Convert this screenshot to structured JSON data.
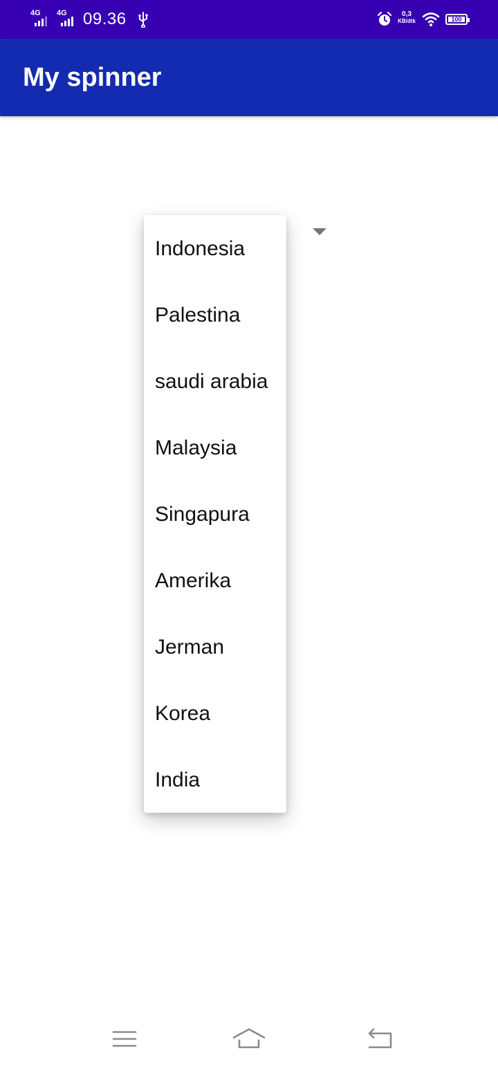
{
  "status_bar": {
    "signal_1_label": "4G",
    "signal_2_label": "4G",
    "time": "09.36",
    "net_speed_value": "0,3",
    "net_speed_unit": "KB/dtk",
    "battery_level": "100",
    "icons": [
      "signal-icon",
      "signal-icon",
      "usb-icon",
      "alarm-icon",
      "wifi-icon",
      "battery-icon"
    ],
    "background_color": "#3700b3"
  },
  "app_bar": {
    "title": "My spinner",
    "background_color": "#132bb0"
  },
  "spinner": {
    "arrow_icon": "dropdown-arrow-icon",
    "options": [
      "Indonesia",
      "Palestina",
      "saudi arabia",
      "Malaysia",
      "Singapura",
      "Amerika",
      "Jerman",
      "Korea",
      "India"
    ]
  },
  "nav_bar": {
    "icons": [
      "menu-icon",
      "home-icon",
      "back-icon"
    ]
  }
}
